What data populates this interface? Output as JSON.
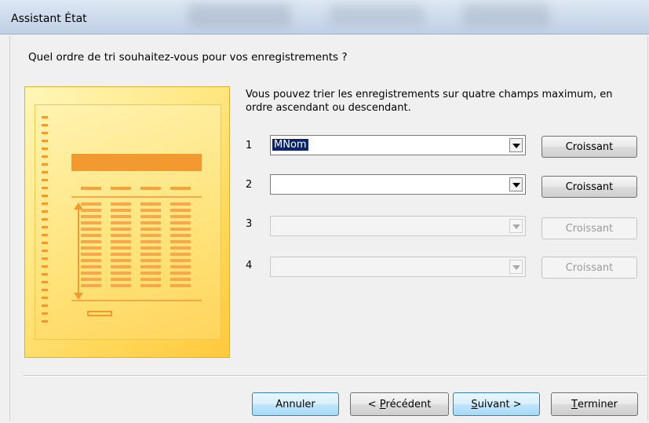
{
  "window": {
    "title": "Assistant État"
  },
  "question": "Quel ordre de tri souhaitez-vous pour vos enregistrements ?",
  "description": "Vous pouvez trier les enregistrements sur quatre champs maximum, en ordre ascendant ou descendant.",
  "sort_rows": [
    {
      "number": "1",
      "value": "MNom",
      "order": "Croissant",
      "enabled": true
    },
    {
      "number": "2",
      "value": "",
      "order": "Croissant",
      "enabled": true
    },
    {
      "number": "3",
      "value": "",
      "order": "Croissant",
      "enabled": false
    },
    {
      "number": "4",
      "value": "",
      "order": "Croissant",
      "enabled": false
    }
  ],
  "footer": {
    "cancel": "Annuler",
    "previous_prefix": "< ",
    "previous_mnemonic": "P",
    "previous_rest": "récédent",
    "next_mnemonic": "S",
    "next_rest": "uivant >",
    "finish_mnemonic": "T",
    "finish_rest": "erminer"
  },
  "colors": {
    "accent_orange": "#f29a30",
    "selection_bg": "#0a246a",
    "default_button_border": "#3c7fb1"
  }
}
